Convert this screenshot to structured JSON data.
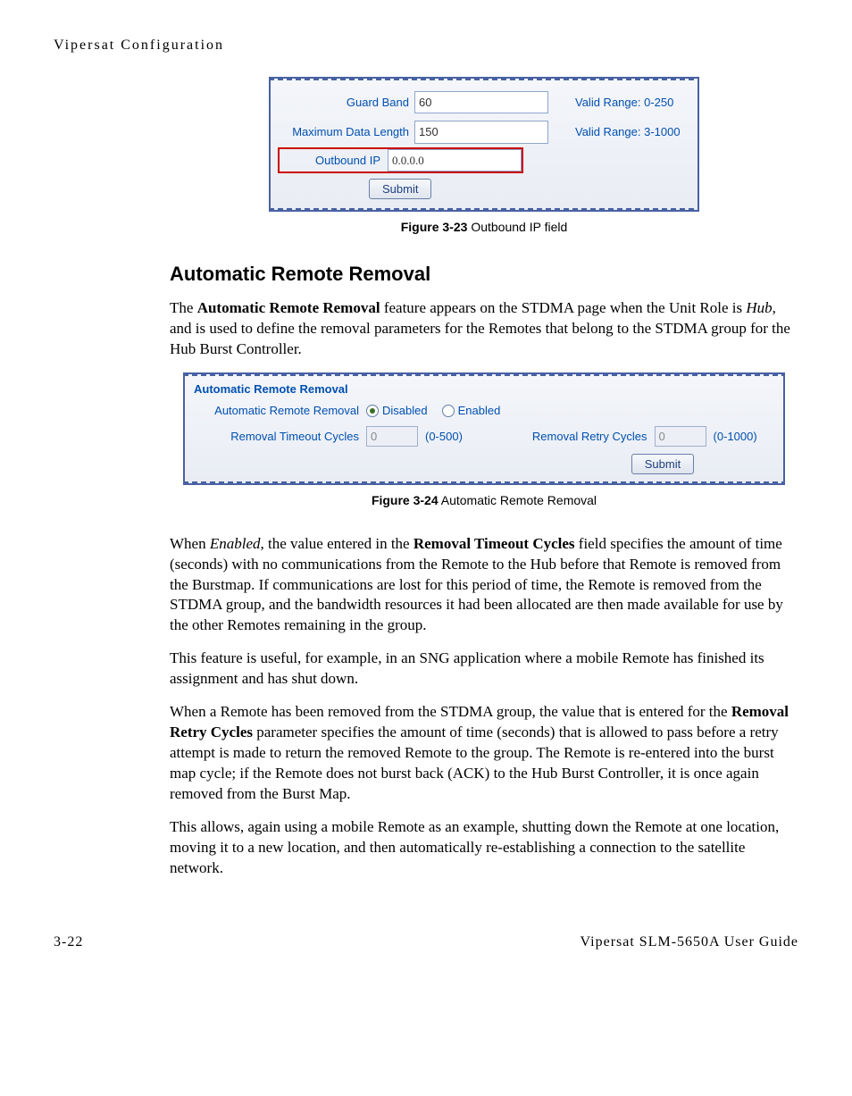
{
  "header": "Vipersat Configuration",
  "fig23": {
    "row1": {
      "label": "Guard Band",
      "value": "60",
      "hint": "Valid Range: 0-250"
    },
    "row2": {
      "label": "Maximum Data Length",
      "value": "150",
      "hint": "Valid Range: 3-1000"
    },
    "row3": {
      "label": "Outbound IP",
      "value": "0.0.0.0"
    },
    "submit": "Submit",
    "caption_bold": "Figure 3-23",
    "caption_text": "   Outbound IP field"
  },
  "section_title": "Automatic Remote Removal",
  "para1_pre": "The ",
  "para1_bold": "Automatic Remote Removal",
  "para1_mid": " feature appears on the STDMA page when the Unit Role is ",
  "para1_em": "Hub",
  "para1_post": ", and is used to define the removal parameters for the Remotes that belong to the STDMA group for the Hub Burst Controller.",
  "fig24": {
    "panel_title": "Automatic Remote Removal",
    "radio_label": "Automatic Remote Removal",
    "radio_disabled": "Disabled",
    "radio_enabled": "Enabled",
    "timeout_label": "Removal Timeout Cycles",
    "timeout_value": "0",
    "timeout_range": "(0-500)",
    "retry_label": "Removal Retry Cycles",
    "retry_value": "0",
    "retry_range": "(0-1000)",
    "submit": "Submit",
    "caption_bold": "Figure 3-24",
    "caption_text": "   Automatic Remote Removal"
  },
  "para2_pre": "When ",
  "para2_em": "Enabled",
  "para2_mid": ", the value entered in the ",
  "para2_bold": "Removal Timeout Cycles",
  "para2_post": " field specifies the amount of time (seconds) with no communications from the Remote to the Hub before that Remote is removed from the Burstmap. If communications are lost for this period of time, the Remote is removed from the STDMA group, and the bandwidth resources it had been allocated are then made available for use by the other Remotes remaining in the group.",
  "para3": "This feature is useful, for example, in an SNG application where a mobile Remote has finished its assignment and has shut down.",
  "para4_pre": "When a Remote has been removed from the STDMA group, the value that is entered for the ",
  "para4_bold": "Removal Retry Cycles",
  "para4_post": " parameter specifies the amount of time (seconds) that is allowed to pass before a retry attempt is made to return the removed Remote to the group. The Remote is re-entered into the burst map cycle; if the Remote does not burst back (ACK) to the Hub Burst Controller, it is once again removed from the Burst Map.",
  "para5": "This allows, again using a mobile Remote as an example, shutting down the Remote at one location, moving it to a new location, and then automatically re-establishing a connection to the satellite network.",
  "footer_left": "3-22",
  "footer_right": "Vipersat SLM-5650A User Guide"
}
